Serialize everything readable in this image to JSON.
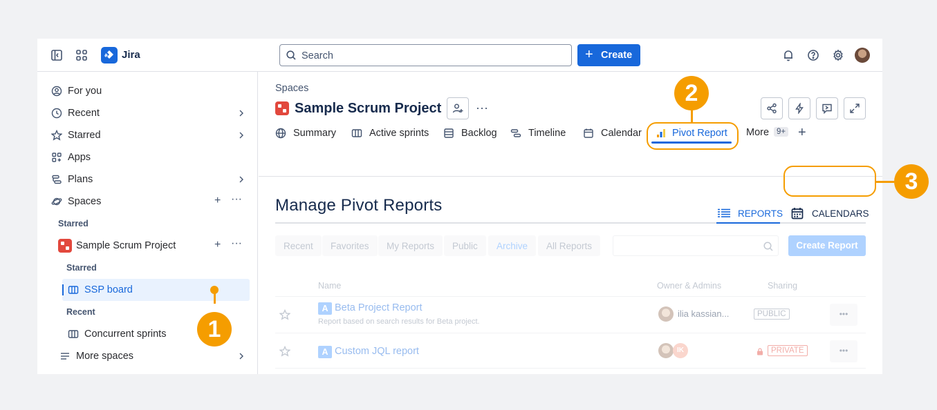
{
  "topbar": {
    "app_name": "Jira",
    "search_placeholder": "Search",
    "create_label": "Create"
  },
  "sidebar": {
    "items": [
      {
        "label": "For you",
        "icon": "person-circle-icon"
      },
      {
        "label": "Recent",
        "icon": "clock-icon"
      },
      {
        "label": "Starred",
        "icon": "star-icon"
      },
      {
        "label": "Apps",
        "icon": "apps-icon"
      },
      {
        "label": "Plans",
        "icon": "plans-icon"
      },
      {
        "label": "Spaces",
        "icon": "planet-icon"
      }
    ],
    "starred_heading": "Starred",
    "project_name": "Sample Scrum Project",
    "project_starred_heading": "Starred",
    "board_name": "SSP board",
    "recent_heading": "Recent",
    "recent_board": "Concurrent sprints",
    "more_spaces": "More spaces"
  },
  "header": {
    "breadcrumb": "Spaces",
    "project_title": "Sample Scrum Project"
  },
  "tabs": [
    {
      "label": "Summary",
      "icon": "globe-icon"
    },
    {
      "label": "Active sprints",
      "icon": "board-icon"
    },
    {
      "label": "Backlog",
      "icon": "backlog-icon"
    },
    {
      "label": "Timeline",
      "icon": "timeline-icon"
    },
    {
      "label": "Calendar",
      "icon": "calendar-icon"
    },
    {
      "label": "Pivot Report",
      "icon": "pivot-icon",
      "active": true
    },
    {
      "label": "More",
      "badge": "9+"
    }
  ],
  "pivot": {
    "title": "Manage Pivot Reports",
    "reports_tab": "REPORTS",
    "calendars_tab": "CALENDARS",
    "filters": [
      "Recent",
      "Favorites",
      "My Reports",
      "Public",
      "Archive",
      "All Reports"
    ],
    "create_report": "Create Report",
    "columns": {
      "name": "Name",
      "owner": "Owner & Admins",
      "sharing": "Sharing"
    },
    "rows": [
      {
        "badge": "A",
        "name": "Beta Project Report",
        "description": "Report based on search results for Beta project.",
        "owner": "ilia kassian...",
        "sharing": "PUBLIC"
      },
      {
        "badge": "A",
        "name": "Custom JQL report",
        "description": "",
        "owner_initials": "IK",
        "sharing": "PRIVATE"
      }
    ]
  },
  "callouts": [
    "1",
    "2",
    "3"
  ],
  "colors": {
    "brand": "#1868db",
    "callout": "#f59d00",
    "project_icon": "#e2483d"
  }
}
